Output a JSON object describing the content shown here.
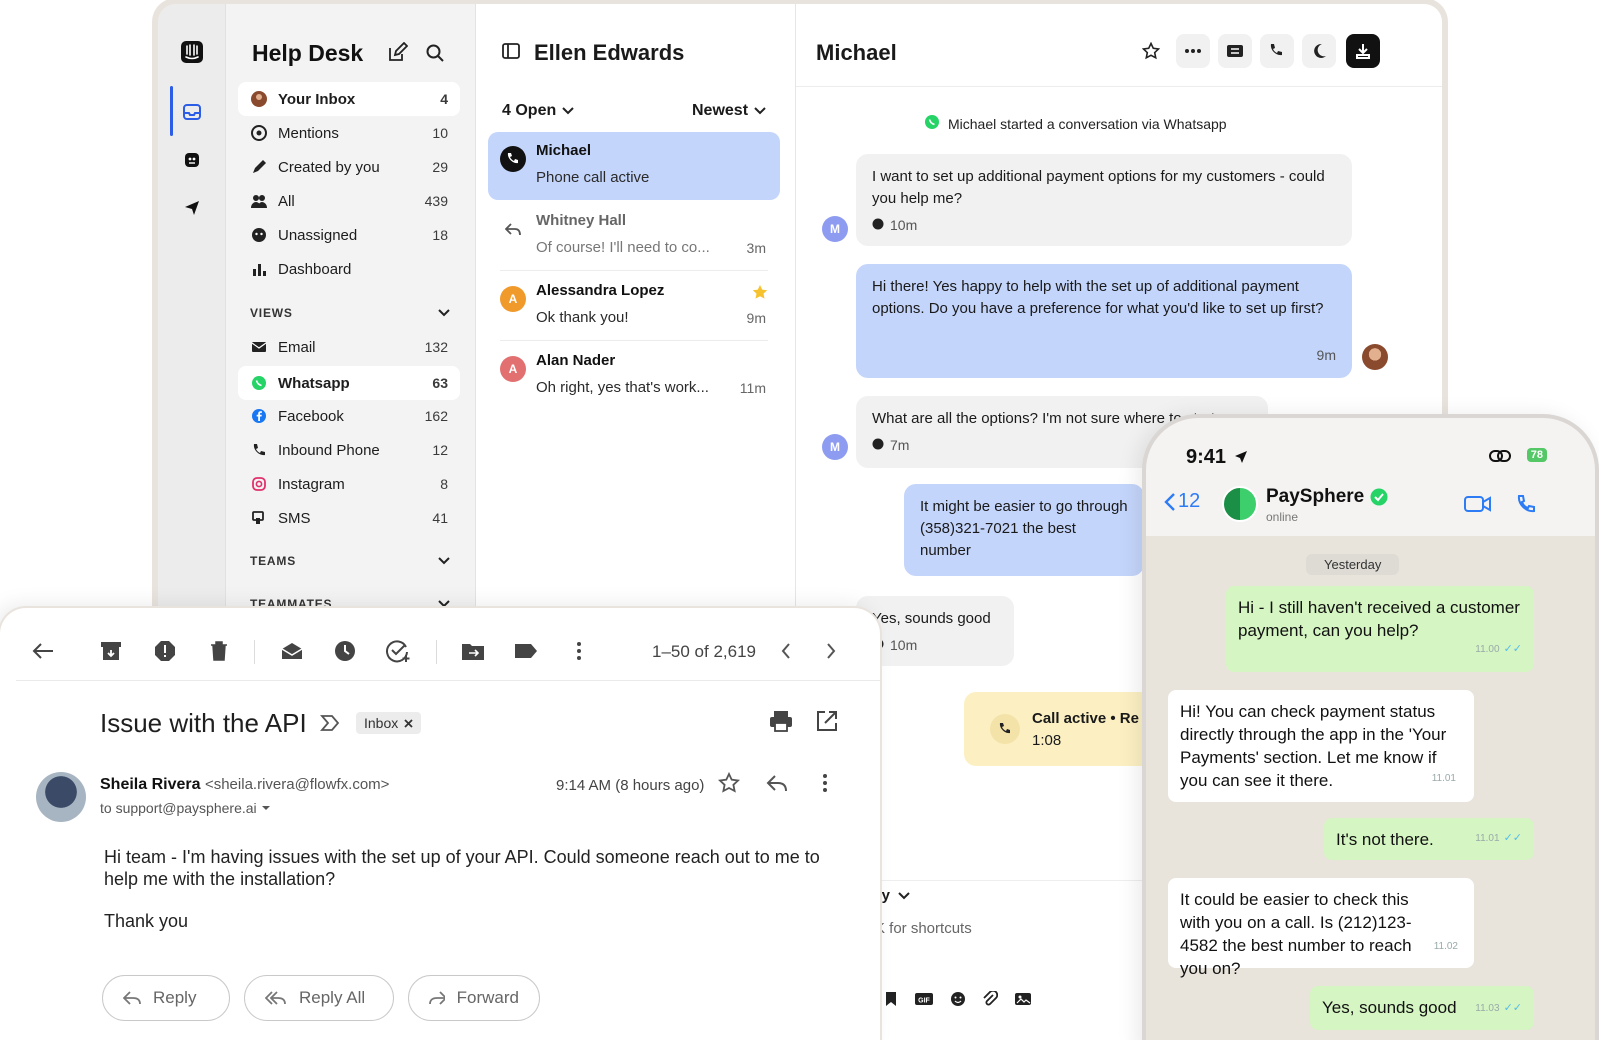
{
  "helpdesk": {
    "nav": {
      "title": "Help Desk",
      "items": [
        {
          "label": "Your Inbox",
          "count": "4"
        },
        {
          "label": "Mentions",
          "count": "10"
        },
        {
          "label": "Created by you",
          "count": "29"
        },
        {
          "label": "All",
          "count": "439"
        },
        {
          "label": "Unassigned",
          "count": "18"
        },
        {
          "label": "Dashboard",
          "count": ""
        }
      ],
      "views_label": "VIEWS",
      "views": [
        {
          "label": "Email",
          "count": "132"
        },
        {
          "label": "Whatsapp",
          "count": "63"
        },
        {
          "label": "Facebook",
          "count": "162"
        },
        {
          "label": "Inbound Phone",
          "count": "12"
        },
        {
          "label": "Instagram",
          "count": "8"
        },
        {
          "label": "SMS",
          "count": "41"
        }
      ],
      "teams_label": "TEAMS",
      "teammates_label": "TEAMMATES"
    },
    "list": {
      "title": "Ellen Edwards",
      "filter_open": "4 Open",
      "filter_sort": "Newest",
      "conversations": [
        {
          "name": "Michael",
          "preview": "Phone call active",
          "time": "",
          "avatar": ""
        },
        {
          "name": "Whitney Hall",
          "preview": "Of course! I'll need to co...",
          "time": "3m",
          "avatar": ""
        },
        {
          "name": "Alessandra Lopez",
          "preview": "Ok thank you!",
          "time": "9m",
          "avatar": "A"
        },
        {
          "name": "Alan Nader",
          "preview": "Oh right, yes that's work...",
          "time": "11m",
          "avatar": "A"
        }
      ]
    },
    "chat": {
      "title": "Michael",
      "system": "Michael started a conversation via Whatsapp",
      "avatar_letter": "M",
      "messages": [
        {
          "text": "I want to set up additional payment options for my customers - could you help me?",
          "time": "10m"
        },
        {
          "text": "Hi there! Yes happy to help with the set up of additional payment options. Do you have a preference for what you'd like to set up first?",
          "time": "9m"
        },
        {
          "text": "What are all the options? I'm not sure where to start",
          "time": "7m"
        },
        {
          "text": "It might be easier to go through (358)321-7021 the best number",
          "time": ""
        },
        {
          "text": "Yes, sounds good",
          "time": "10m"
        }
      ],
      "call": {
        "label": "Call active • Re",
        "duration": "1:08"
      },
      "reply_label": "eply",
      "shortcut_hint": "⌘K for shortcuts"
    }
  },
  "gmail": {
    "count": "1–50 of 2,619",
    "subject": "Issue with the API",
    "label": "Inbox",
    "sender_name": "Sheila Rivera",
    "sender_email": "<sheila.rivera@flowfx.com>",
    "to": "to support@paysphere.ai",
    "time": "9:14 AM (8 hours ago)",
    "body": [
      "Hi team - I'm having issues with the set up of your API. Could someone reach out to me to help me with the installation?",
      "Thank you"
    ],
    "buttons": {
      "reply": "Reply",
      "reply_all": "Reply All",
      "forward": "Forward"
    }
  },
  "phone": {
    "time": "9:41",
    "battery": "78",
    "back_count": "12",
    "contact": "PaySphere",
    "status": "online",
    "day": "Yesterday",
    "messages": [
      {
        "text": "Hi - I still haven't received a customer payment, can you help?",
        "time": "11.00",
        "dir": "out"
      },
      {
        "text": "Hi! You can check payment status directly through the app in the 'Your Payments' section. Let me know if you can see it there.",
        "time": "11.01",
        "dir": "in"
      },
      {
        "text": "It's not there.",
        "time": "11.01",
        "dir": "out"
      },
      {
        "text": "It could be easier to check this with you on a call. Is (212)123-4582 the best number to reach you on?",
        "time": "11.02",
        "dir": "in"
      },
      {
        "text": "Yes, sounds good",
        "time": "11.03",
        "dir": "out"
      }
    ]
  },
  "colors": {
    "accent": "#2b5de6",
    "selected": "#c4d5fb",
    "whatsapp": "#25d366",
    "call": "#fcf0c3"
  }
}
